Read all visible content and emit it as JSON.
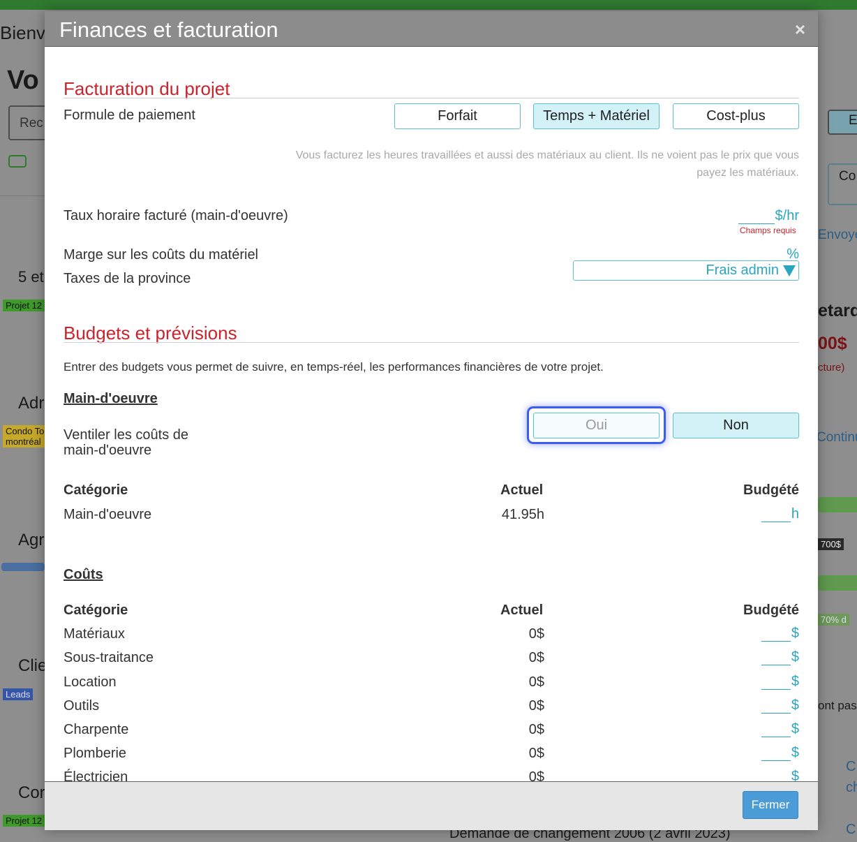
{
  "background": {
    "left_labels": [
      "Bienv",
      "Vo",
      "Rec",
      "5 et",
      "Adr",
      "Agr",
      "Clie",
      "Cor"
    ],
    "tags": [
      "Projet 12",
      "Condo To",
      "montréal",
      "Leads",
      "Projet 12"
    ],
    "right_labels": [
      "E",
      "Co",
      "Envoye",
      "etard",
      "00$",
      "cture)",
      "Continu",
      "700$",
      "70%  d",
      "ont pas",
      "C",
      "ch",
      "C"
    ],
    "bottom_text": "Demande de changement 2006 (2 avril 2023)"
  },
  "modal": {
    "title": "Finances et facturation",
    "close_icon": "×",
    "footer_button": "Fermer"
  },
  "billing": {
    "title": "Facturation du projet",
    "payment_label": "Formule de paiement",
    "options": [
      "Forfait",
      "Temps + Matériel",
      "Cost-plus"
    ],
    "selected_option": "Temps + Matériel",
    "description": "Vous facturez les heures travaillées et aussi des matériaux au client. Ils ne voient pas le prix que vous payez les matériaux.",
    "rate_label": "Taux horaire facturé (main-d'oeuvre)",
    "rate_unit": "$/hr",
    "rate_required": "Champs requis",
    "margin_label": "Marge sur les coûts du matériel",
    "margin_unit": "%",
    "tax_label": "Taxes de la province",
    "tax_value": "Frais admin"
  },
  "budgets": {
    "title": "Budgets et prévisions",
    "intro": "Entrer des budgets vous permet de suivre, en temps-réel, les performances financières de votre projet.",
    "labor": {
      "title": "Main-d'oeuvre",
      "split_label_line1": "Ventiler les coûts de",
      "split_label_line2": "main-d'oeuvre",
      "yes": "Oui",
      "no": "Non",
      "headers": [
        "Catégorie",
        "Actuel",
        "Budgété"
      ],
      "rows": [
        {
          "category": "Main-d'oeuvre",
          "actual": "41.95h",
          "unit": "h"
        }
      ]
    },
    "costs": {
      "title": "Coûts",
      "headers": [
        "Catégorie",
        "Actuel",
        "Budgété"
      ],
      "rows": [
        {
          "category": "Matériaux",
          "actual": "0$",
          "unit": "$"
        },
        {
          "category": "Sous-traitance",
          "actual": "0$",
          "unit": "$"
        },
        {
          "category": "Location",
          "actual": "0$",
          "unit": "$"
        },
        {
          "category": "Outils",
          "actual": "0$",
          "unit": "$"
        },
        {
          "category": "Charpente",
          "actual": "0$",
          "unit": "$"
        },
        {
          "category": "Plomberie",
          "actual": "0$",
          "unit": "$"
        },
        {
          "category": "Électricien",
          "actual": "0$",
          "unit": "$"
        }
      ]
    }
  },
  "colors": {
    "accent_red": "#c9232b",
    "accent_teal": "#2aa5c0",
    "button_blue": "#4a9bd6"
  }
}
